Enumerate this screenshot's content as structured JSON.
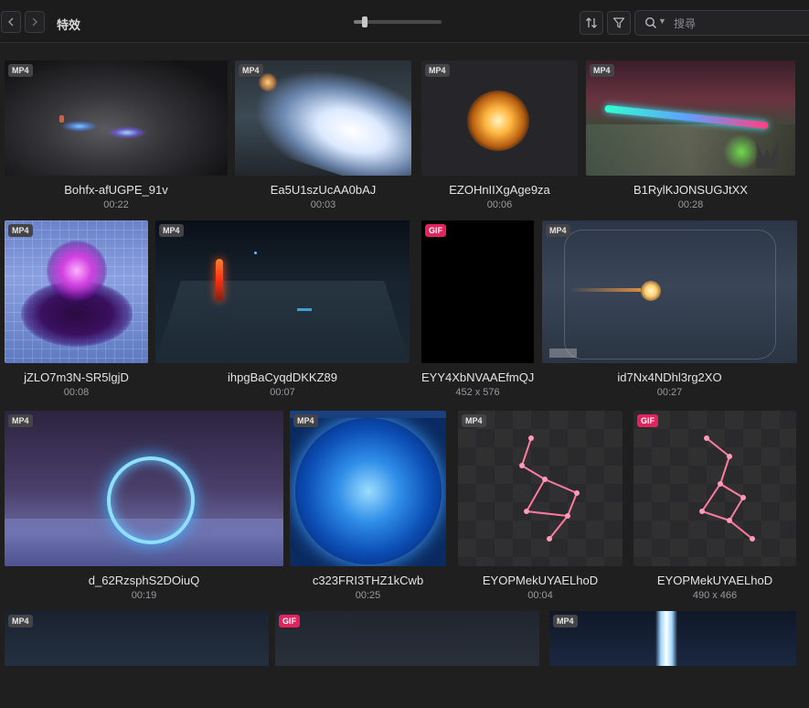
{
  "toolbar": {
    "title": "特效",
    "back_icon": "chevron-left-icon",
    "forward_icon": "chevron-right-icon",
    "zoom_level": 0.13,
    "sort_icon": "sort-icon",
    "filter_icon": "filter-icon",
    "search": {
      "placeholder": "搜尋",
      "value": ""
    }
  },
  "items": [
    {
      "name": "Bohfx-afUGPE_91v",
      "meta": "00:22",
      "badge": "MP4"
    },
    {
      "name": "Ea5U1szUcAA0bAJ",
      "meta": "00:03",
      "badge": "MP4"
    },
    {
      "name": "EZOHnIIXgAge9za",
      "meta": "00:06",
      "badge": "MP4"
    },
    {
      "name": "B1RylKJONSUGJtXX",
      "meta": "00:28",
      "badge": "MP4"
    },
    {
      "name": "jZLO7m3N-SR5lgjD",
      "meta": "00:08",
      "badge": "MP4"
    },
    {
      "name": "ihpgBaCyqdDKKZ89",
      "meta": "00:07",
      "badge": "MP4"
    },
    {
      "name": "EYY4XbNVAAEfmQJ",
      "meta": "452 x 576",
      "badge": "GIF"
    },
    {
      "name": "id7Nx4NDhl3rg2XO",
      "meta": "00:27",
      "badge": "MP4"
    },
    {
      "name": "d_62RzsphS2DOiuQ",
      "meta": "00:19",
      "badge": "MP4"
    },
    {
      "name": "c323FRI3THZ1kCwb",
      "meta": "00:25",
      "badge": "MP4"
    },
    {
      "name": "EYOPMekUYAELhoD",
      "meta": "00:04",
      "badge": "MP4"
    },
    {
      "name": "EYOPMekUYAELhoD",
      "meta": "490 x 466",
      "badge": "GIF"
    },
    {
      "name": "",
      "meta": "",
      "badge": "MP4"
    },
    {
      "name": "",
      "meta": "",
      "badge": "GIF"
    },
    {
      "name": "",
      "meta": "",
      "badge": "MP4"
    }
  ]
}
